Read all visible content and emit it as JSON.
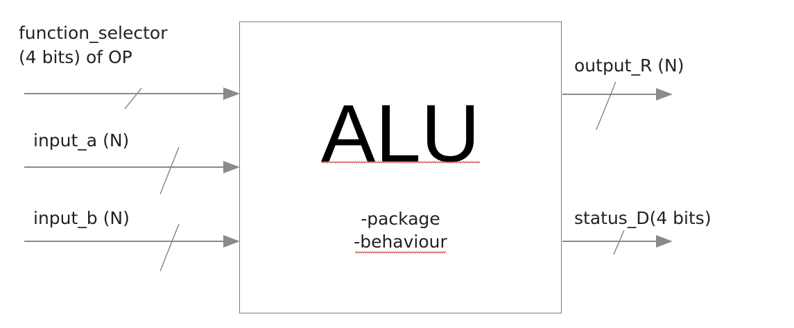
{
  "block": {
    "title": "ALU",
    "lines": [
      "-package",
      "-behaviour"
    ]
  },
  "inputs": [
    {
      "label_lines": [
        "function_selector",
        "(4 bits) of OP"
      ]
    },
    {
      "label_lines": [
        "input_a (N)"
      ]
    },
    {
      "label_lines": [
        "input_b (N)"
      ]
    }
  ],
  "outputs": [
    {
      "label_lines": [
        "output_R (N)"
      ]
    },
    {
      "label_lines": [
        "status_D(4 bits)"
      ]
    }
  ],
  "colors": {
    "wire": "#8a8a8a",
    "box_border": "#7a7a7a",
    "text": "#222222",
    "title": "#000000",
    "spellcheck_underline": "#d64545"
  }
}
